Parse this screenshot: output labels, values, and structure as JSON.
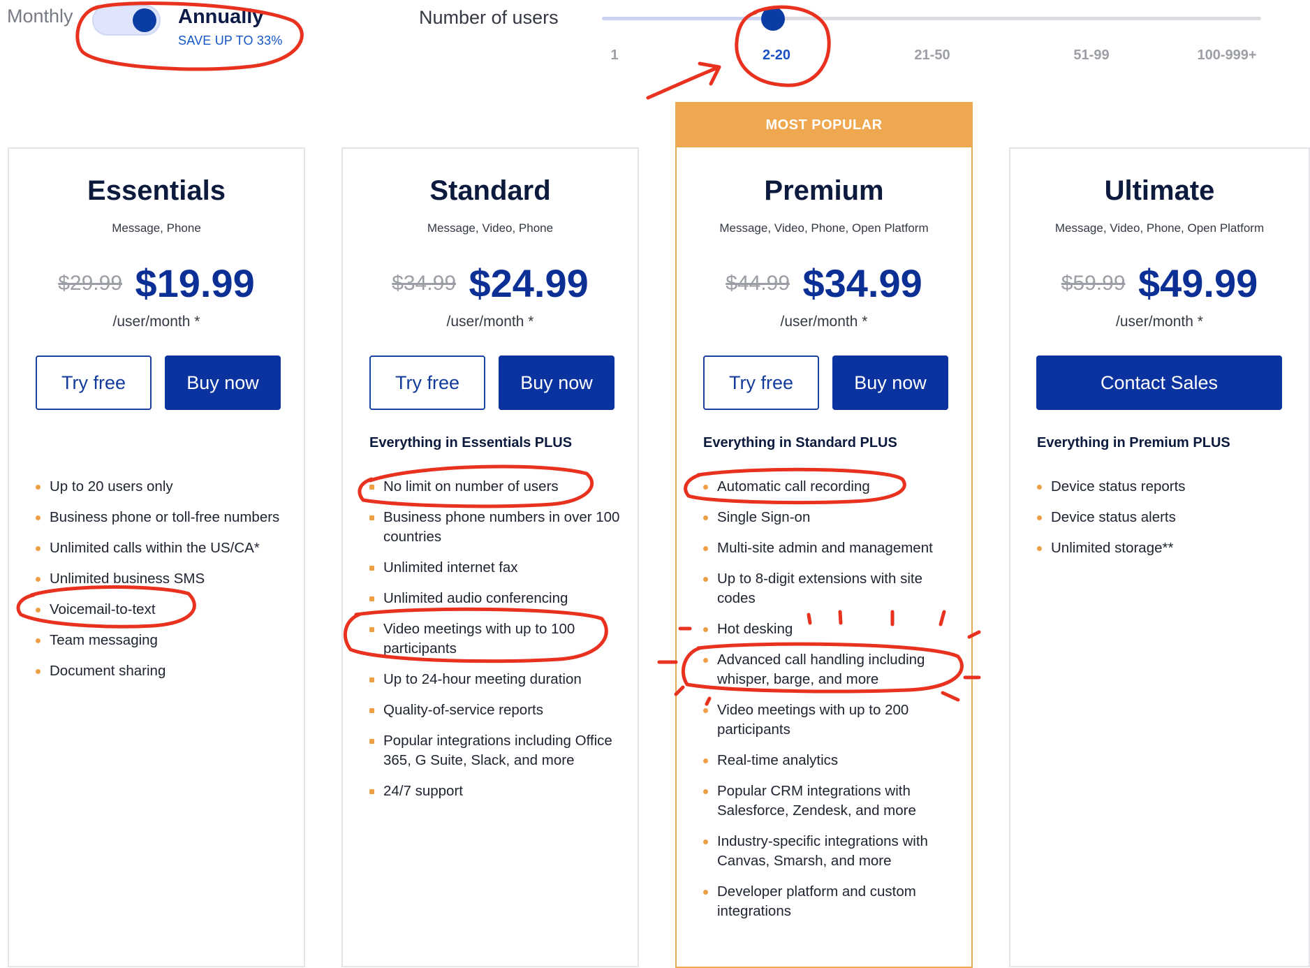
{
  "billing": {
    "monthly_label": "Monthly",
    "annually_label": "Annually",
    "save_text": "SAVE UP TO 33%",
    "selected": "Annually"
  },
  "users_slider": {
    "label": "Number of users",
    "ticks": [
      "1",
      "2-20",
      "21-50",
      "51-99",
      "100-999+"
    ],
    "selected": "2-20"
  },
  "popular_banner": "MOST POPULAR",
  "plans": [
    {
      "name": "Essentials",
      "channels": "Message, Phone",
      "old_price": "$29.99",
      "price": "$19.99",
      "per_user": "/user/month *",
      "try_label": "Try free",
      "buy_label": "Buy now",
      "everything": "",
      "features": [
        "Up to 20 users only",
        "Business phone or toll-free numbers",
        "Unlimited calls within the US/CA*",
        "Unlimited business SMS",
        "Voicemail-to-text",
        "Team messaging",
        "Document sharing"
      ]
    },
    {
      "name": "Standard",
      "channels": "Message, Video, Phone",
      "old_price": "$34.99",
      "price": "$24.99",
      "per_user": "/user/month *",
      "try_label": "Try free",
      "buy_label": "Buy now",
      "everything": "Everything in Essentials PLUS",
      "features": [
        "No limit on number of users",
        "Business phone numbers in over 100 countries",
        "Unlimited internet fax",
        "Unlimited audio conferencing",
        "Video meetings with up to 100 participants",
        "Up to 24-hour meeting duration",
        "Quality-of-service reports",
        "Popular integrations including Office 365, G Suite, Slack, and more",
        "24/7 support"
      ]
    },
    {
      "name": "Premium",
      "channels": "Message, Video, Phone, Open Platform",
      "old_price": "$44.99",
      "price": "$34.99",
      "per_user": "/user/month *",
      "try_label": "Try free",
      "buy_label": "Buy now",
      "everything": "Everything in Standard PLUS",
      "features": [
        "Automatic call recording",
        "Single Sign-on",
        "Multi-site admin and management",
        "Up to 8-digit extensions with site codes",
        "Hot desking",
        "Advanced call handling including whisper, barge, and more",
        "Video meetings with up to 200 participants",
        "Real-time analytics",
        "Popular CRM integrations with Salesforce, Zendesk, and more",
        "Industry-specific integrations with Canvas, Smarsh, and more",
        "Developer platform and custom integrations"
      ]
    },
    {
      "name": "Ultimate",
      "channels": "Message, Video, Phone, Open Platform",
      "old_price": "$59.99",
      "price": "$49.99",
      "per_user": "/user/month *",
      "contact_label": "Contact Sales",
      "everything": "Everything in Premium PLUS",
      "features": [
        "Device status reports",
        "Device status alerts",
        "Unlimited storage**"
      ]
    }
  ],
  "colors": {
    "brand_blue": "#0b33a0",
    "accent_orange": "#efa84f",
    "annotation_red": "#e8321f"
  }
}
